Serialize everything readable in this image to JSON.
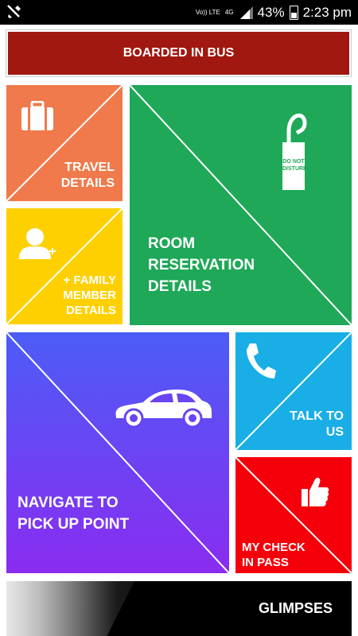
{
  "status_bar": {
    "volte_label": "Vo)) LTE",
    "network_label": "4G",
    "battery_percent": "43%",
    "time": "2:23 pm"
  },
  "top_banner": {
    "label": "BOARDED IN BUS",
    "color": "#a0180f"
  },
  "tiles": {
    "travel": {
      "label_line1": "TRAVEL",
      "label_line2": "DETAILS",
      "color": "#f07a4b",
      "icon": "suitcase-icon"
    },
    "family": {
      "label_line1": "+ FAMILY",
      "label_line2": "MEMBER",
      "label_line3": "DETAILS",
      "color": "#ffd000",
      "icon": "add-person-icon"
    },
    "room": {
      "label_line1": "ROOM",
      "label_line2": "RESERVATION",
      "label_line3": "DETAILS",
      "color": "#1ea858",
      "icon": "do-not-disturb-hanger-icon",
      "hanger_text_line1": "DO NOT",
      "hanger_text_line2": "DISTURB"
    },
    "navigate": {
      "label_line1": "NAVIGATE TO",
      "label_line2": "PICK UP POINT",
      "gradient_from": "#4c5df6",
      "gradient_to": "#8a2cf0",
      "icon": "car-icon"
    },
    "talk": {
      "label_line1": "TALK TO",
      "label_line2": "US",
      "color": "#19aee6",
      "icon": "phone-icon"
    },
    "checkin": {
      "label_line1": "MY CHECK",
      "label_line2": "IN PASS",
      "color": "#f5000a",
      "icon": "thumbs-up-icon"
    }
  },
  "glimpses": {
    "label": "GLIMPSES"
  }
}
